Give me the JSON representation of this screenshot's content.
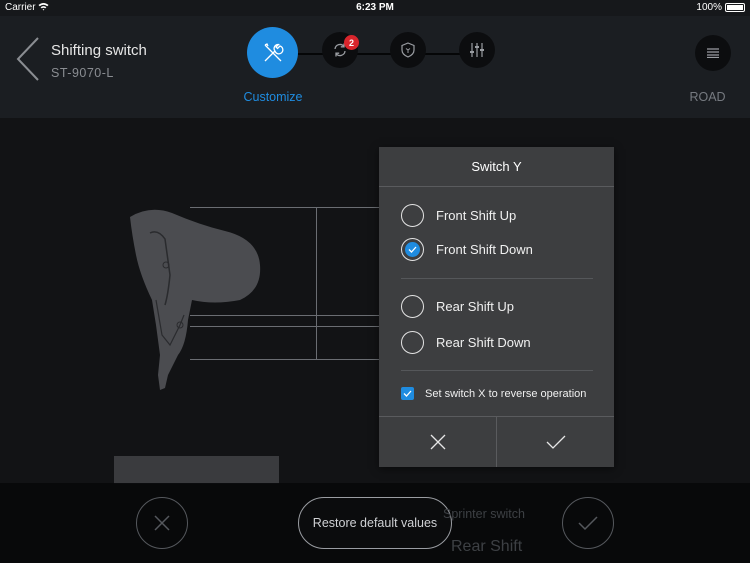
{
  "status_bar": {
    "carrier": "Carrier",
    "time": "6:23 PM",
    "battery": "100%"
  },
  "header": {
    "title": "Shifting switch",
    "subtitle": "ST-9070-L",
    "steps": [
      {
        "icon": "tools-icon",
        "label": "Customize",
        "active": true
      },
      {
        "icon": "sync-icon",
        "badge": "2"
      },
      {
        "icon": "shield-icon"
      },
      {
        "icon": "sliders-icon"
      }
    ],
    "mode_label": "ROAD"
  },
  "background": {
    "restore_label": "Restore default values",
    "sprinter_label": "Sprinter switch",
    "rear_shift_label": "Rear Shift"
  },
  "dialog": {
    "title": "Switch Y",
    "options": [
      {
        "label": "Front Shift Up",
        "checked": false
      },
      {
        "label": "Front Shift Down",
        "checked": true
      },
      {
        "label": "Rear Shift Up",
        "checked": false
      },
      {
        "label": "Rear Shift Down",
        "checked": false
      }
    ],
    "reverse_label": "Set switch X to reverse operation",
    "reverse_checked": true
  },
  "colors": {
    "accent": "#1f8ce0",
    "badge": "#d9252c",
    "header_bg": "#1b1e22",
    "dialog_bg": "#3d3e40"
  }
}
